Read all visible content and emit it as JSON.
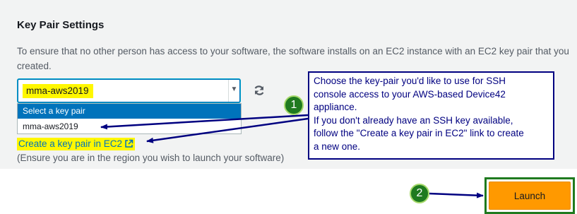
{
  "section": {
    "title": "Key Pair Settings",
    "description": "To ensure that no other person has access to your software, the software installs on an EC2 instance with an EC2 key pair that you created."
  },
  "key_pair_select": {
    "selected_value": "mma-aws2019",
    "options": [
      "Select a key pair",
      "mma-aws2019"
    ]
  },
  "create_link": {
    "label": "Create a key pair in EC2"
  },
  "region_note": "(Ensure you are in the region you wish to launch your software)",
  "callout": {
    "line1": "Choose the key-pair you'd like to use for SSH",
    "line2": "console access to your AWS-based Device42",
    "line3": "appliance.",
    "line4": "If you don't already have an SSH key available,",
    "line5": "follow the \"Create a key pair in EC2\" link to create",
    "line6": "a new one."
  },
  "badges": {
    "first": "1",
    "second": "2"
  },
  "launch_button": {
    "label": "Launch"
  },
  "icons": {
    "refresh": "refresh-icon",
    "external": "external-link-icon",
    "dropdown": "chevron-down-icon"
  },
  "colors": {
    "highlight": "#fff700",
    "callout_border": "#000080",
    "badge_green": "#1f7a1f",
    "launch_orange": "#ff9900",
    "selected_blue": "#0073bb"
  }
}
